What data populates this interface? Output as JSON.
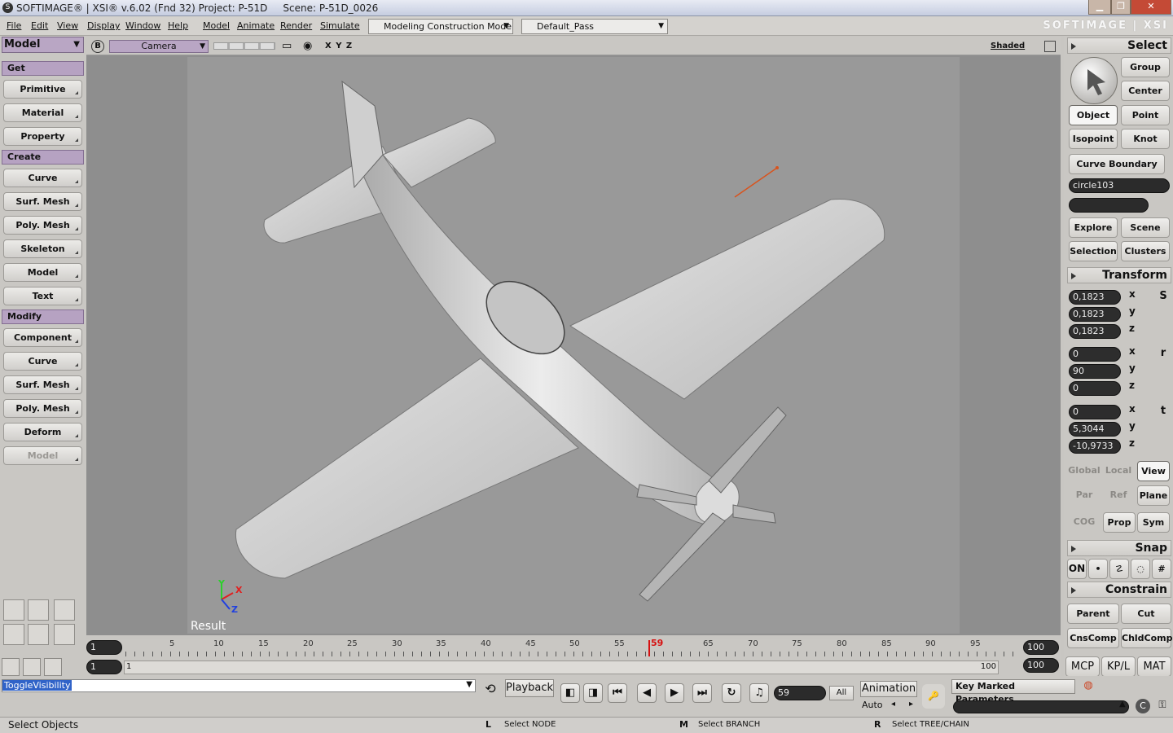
{
  "title": {
    "text": "SOFTIMAGE® | XSI® v.6.02 (Fnd 32) Project: P-51D     Scene: P-51D_0026"
  },
  "menus": [
    "File",
    "Edit",
    "View",
    "Display",
    "Window",
    "Help",
    "Model",
    "Animate",
    "Render",
    "Simulate"
  ],
  "mode_combo": "Modeling Construction Mode",
  "pass_combo": "Default_Pass",
  "brand": "SOFTIMAGE | XSI",
  "left": {
    "module": "Model",
    "get": "Get",
    "get_items": [
      "Primitive",
      "Material",
      "Property"
    ],
    "create": "Create",
    "create_items": [
      "Curve",
      "Surf. Mesh",
      "Poly. Mesh",
      "Skeleton",
      "Model",
      "Text"
    ],
    "modify": "Modify",
    "modify_items": [
      "Component",
      "Curve",
      "Surf. Mesh",
      "Poly. Mesh",
      "Deform",
      "Model"
    ]
  },
  "viewport": {
    "letter": "B",
    "camera": "Camera",
    "axes": "X Y Z",
    "shading": "Shaded",
    "result": "Result",
    "gx": "X",
    "gy": "Y",
    "gz": "Z"
  },
  "right": {
    "select_head": "Select",
    "group": "Group",
    "center": "Center",
    "object": "Object",
    "point": "Point",
    "isopoint": "Isopoint",
    "knot": "Knot",
    "curve_boundary": "Curve Boundary",
    "selection_name": "circle103",
    "explore": "Explore",
    "scene": "Scene",
    "selection": "Selection",
    "clusters": "Clusters",
    "transform_head": "Transform",
    "scale": [
      "0,1823",
      "0,1823",
      "0,1823"
    ],
    "rotate": [
      "0",
      "90",
      "0"
    ],
    "translate": [
      "0",
      "5,3044",
      "-10,9733"
    ],
    "s": "S",
    "r": "r",
    "t": "t",
    "x": "x",
    "y": "y",
    "z": "z",
    "global": "Global",
    "local": "Local",
    "view": "View",
    "par": "Par",
    "ref": "Ref",
    "plane": "Plane",
    "cog": "COG",
    "prop": "Prop",
    "sym": "Sym",
    "snap_head": "Snap",
    "snap_on": "ON",
    "constrain_head": "Constrain",
    "parent": "Parent",
    "cut": "Cut",
    "cnscomp": "CnsComp",
    "chldcomp": "ChldComp",
    "mcp": "MCP",
    "kpl": "KP/L",
    "mat": "MAT"
  },
  "timeline": {
    "start": "1",
    "end": "100",
    "ticks": [
      "5",
      "10",
      "15",
      "20",
      "25",
      "30",
      "35",
      "40",
      "45",
      "50",
      "55",
      "65",
      "70",
      "75",
      "80",
      "85",
      "90",
      "95"
    ],
    "current_label": "59",
    "range_start": "1",
    "range_start2": "1",
    "range_end": "100",
    "range_end2": "100"
  },
  "bottom": {
    "command": "ToggleVisibility",
    "playback": "Playback",
    "frame": "59",
    "all": "All",
    "animation": "Animation",
    "auto": "Auto",
    "key_marked": "Key Marked Parameters"
  },
  "status": {
    "left": "Select Objects",
    "l_key": "L",
    "l_text": "Select NODE",
    "m_key": "M",
    "m_text": "Select BRANCH",
    "r_key": "R",
    "r_text": "Select TREE/CHAIN"
  },
  "colors": {
    "accent_purple": "#b6a2c2",
    "field_dark": "#2d2d2d",
    "viewport_bg": "#999999",
    "playhead": "#d61010"
  }
}
